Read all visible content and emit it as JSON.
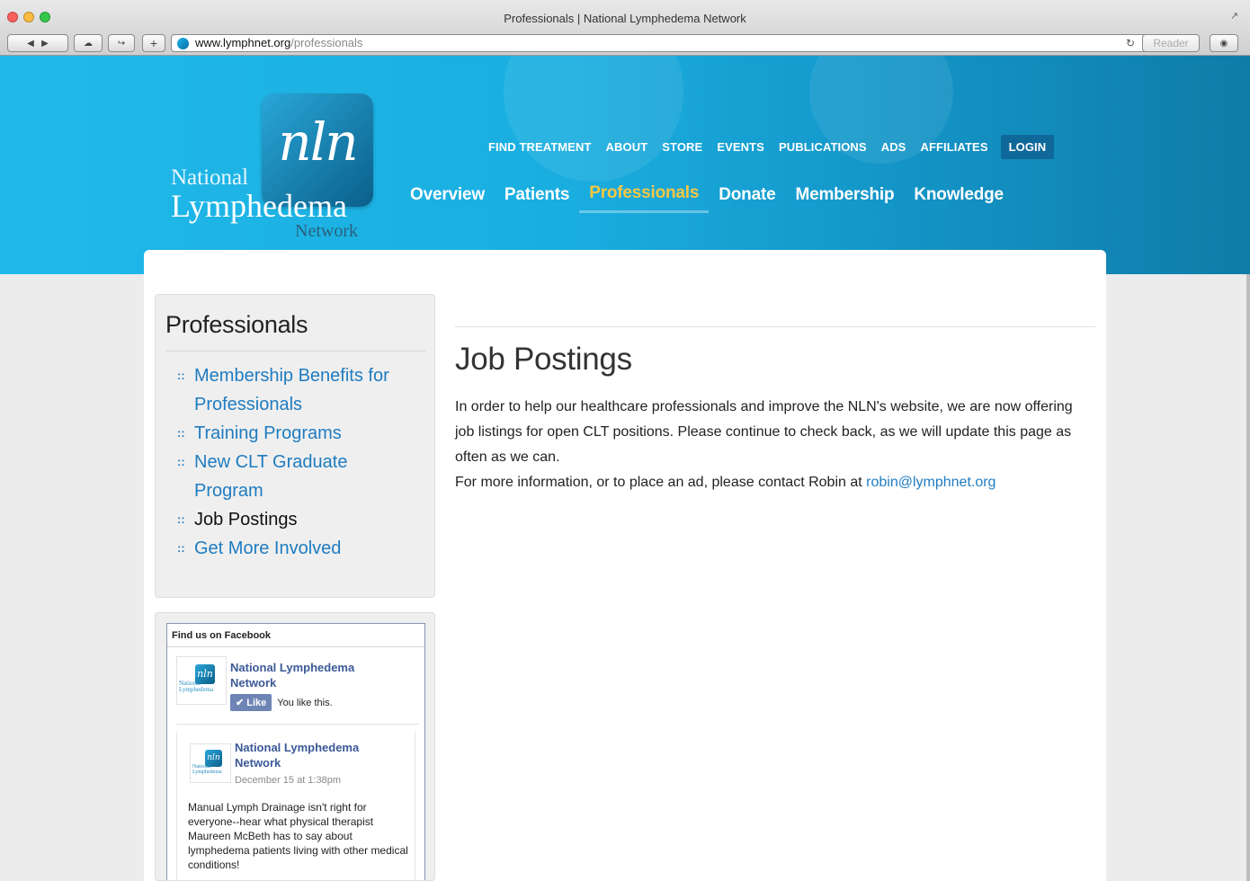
{
  "browser": {
    "window_title": "Professionals | National Lymphedema Network",
    "url_host": "www.lymphnet.org",
    "url_path": "/professionals",
    "reader_label": "Reader"
  },
  "logo": {
    "mark": "nln",
    "line1": "National",
    "line2": "Lymphedema",
    "line3": "Network"
  },
  "top_nav": [
    {
      "label": "FIND TREATMENT"
    },
    {
      "label": "ABOUT"
    },
    {
      "label": "STORE"
    },
    {
      "label": "EVENTS"
    },
    {
      "label": "PUBLICATIONS"
    },
    {
      "label": "ADS"
    },
    {
      "label": "AFFILIATES"
    },
    {
      "label": "LOGIN"
    }
  ],
  "main_nav": [
    {
      "label": "Overview"
    },
    {
      "label": "Patients"
    },
    {
      "label": "Professionals",
      "active": true
    },
    {
      "label": "Donate"
    },
    {
      "label": "Membership"
    },
    {
      "label": "Knowledge"
    }
  ],
  "sidebar": {
    "title": "Professionals",
    "bullet": "::",
    "links": [
      {
        "label": "Membership Benefits for Professionals"
      },
      {
        "label": "Training Programs"
      },
      {
        "label": "New CLT Graduate Program"
      },
      {
        "label": "Job Postings",
        "current": true
      },
      {
        "label": "Get More Involved"
      }
    ]
  },
  "facebook": {
    "heading": "Find us on Facebook",
    "page_name": "National Lymphedema Network",
    "like_label": "Like",
    "like_status": "You like this.",
    "post": {
      "author": "National Lymphedema Network",
      "date": "December 15 at 1:38pm",
      "text": "Manual Lymph Drainage isn't right for everyone--hear what physical therapist Maureen McBeth has to say about lymphedema patients living with other medical conditions!"
    }
  },
  "main": {
    "heading": "Job Postings",
    "paragraph": "In order to help our healthcare professionals and improve the NLN's website,  we are now offering job listings for open CLT positions. Please continue to check back, as we will update this page as often as we can.",
    "contact_text": "For more information, or to place an ad, please contact Robin at ",
    "contact_email": "robin@lymphnet.org"
  },
  "colors": {
    "header_blue": "#1aaee0",
    "link_blue": "#1f7cc0",
    "active_nav": "#f6c744",
    "facebook_blue": "#3b5998"
  }
}
